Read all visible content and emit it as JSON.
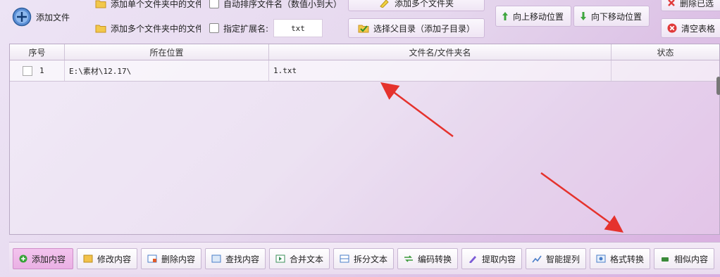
{
  "toolbar": {
    "add_file": "添加文件",
    "add_single_folder_files": "添加单个文件夹中的文件",
    "add_multi_folder_files": "添加多个文件夹中的文件",
    "auto_sort": "自动排序文件名（数值小到大）",
    "specify_ext": "指定扩展名:",
    "ext_value": "txt",
    "add_multi_folders": "添加多个文件夹",
    "select_parent_dir": "选择父目录（添加子目录）",
    "move_up": "向上移动位置",
    "move_down": "向下移动位置",
    "delete_selected": "删除已选",
    "clear_table": "清空表格"
  },
  "table": {
    "columns": [
      "序号",
      "所在位置",
      "文件名/文件夹名",
      "状态"
    ],
    "rows": [
      {
        "index": "1",
        "location": "E:\\素材\\12.17\\",
        "filename": "1.txt",
        "status": ""
      }
    ]
  },
  "bottom": {
    "buttons": [
      "添加内容",
      "修改内容",
      "删除内容",
      "查找内容",
      "合并文本",
      "拆分文本",
      "编码转换",
      "提取内容",
      "智能提列",
      "格式转换",
      "相似内容"
    ]
  },
  "colors": {
    "accent": "#e8b0e2",
    "annotation_arrow": "#e5322d"
  },
  "icons": [
    "add-circle-icon",
    "folder-icon",
    "sparkle-icon",
    "check-folder-icon",
    "arrow-up-icon",
    "arrow-down-icon",
    "delete-x-icon",
    "clear-icon"
  ]
}
